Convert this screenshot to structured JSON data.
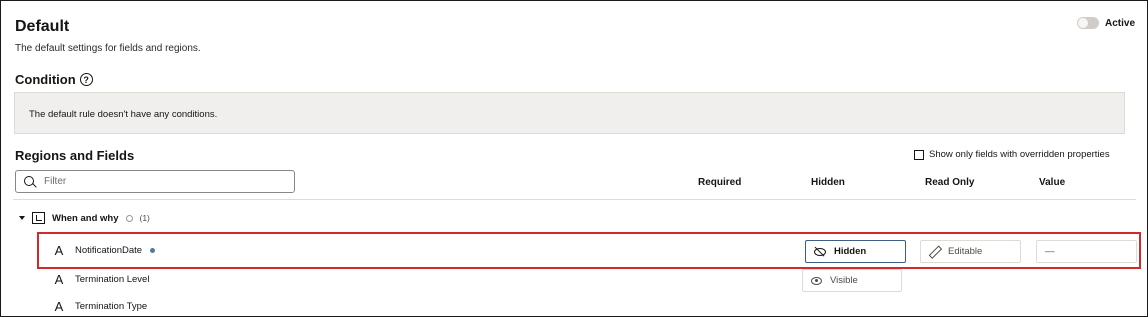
{
  "header": {
    "title": "Default",
    "description": "The default settings for fields and regions.",
    "active_label": "Active",
    "active_on": false
  },
  "condition": {
    "title": "Condition",
    "help_icon": "help-circle-icon",
    "help_glyph": "?",
    "message": "The default rule doesn't have any conditions."
  },
  "regions": {
    "title": "Regions and Fields",
    "override_label": "Show only fields with overridden properties",
    "filter_placeholder": "Filter",
    "columns": {
      "required": "Required",
      "hidden": "Hidden",
      "read_only": "Read Only",
      "value": "Value"
    },
    "group": {
      "label": "When and why",
      "count": "(1)"
    },
    "fields": [
      {
        "label": "NotificationDate",
        "type_glyph": "A",
        "modified": true,
        "hidden_label": "Hidden",
        "read_only_label": "Editable",
        "value_label": "—"
      },
      {
        "label": "Termination Level",
        "type_glyph": "A",
        "hidden_label": "Visible"
      },
      {
        "label": "Termination Type",
        "type_glyph": "A"
      }
    ]
  },
  "colors": {
    "highlight": "#d22a2a",
    "selected_border": "#3b5f8a",
    "modified_dot": "#4f7d9c",
    "condition_bg": "#f1efed"
  }
}
